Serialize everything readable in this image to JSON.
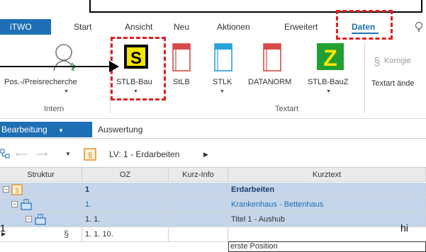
{
  "menubar": {
    "app": "iTWO",
    "items": [
      "Start",
      "Ansicht",
      "Neu",
      "Aktionen",
      "Erweitert",
      "Daten"
    ],
    "active": "Daten"
  },
  "ribbon": {
    "buttons": [
      {
        "label": "Pos.-/Preisrecherche",
        "icon": "search-person-icon"
      },
      {
        "label": "STLB-Bau",
        "icon": "stlb-s-icon"
      },
      {
        "label": "StLB",
        "icon": "red-book-icon"
      },
      {
        "label": "STLK",
        "icon": "blue-book-icon"
      },
      {
        "label": "DATANORM",
        "icon": "red-book-icon"
      },
      {
        "label": "STLB-BauZ",
        "icon": "stlb-z-icon"
      },
      {
        "label": "Korrigie",
        "icon": "paragraph-icon"
      },
      {
        "label": "Textart ände",
        "icon": ""
      }
    ],
    "groups": [
      "Intern",
      "Textart"
    ]
  },
  "tabs": {
    "bearbeitung": "Bearbeitung",
    "auswertung": "Auswertung"
  },
  "nav": {
    "breadcrumb": "LV: 1 - Erdarbeiten"
  },
  "grid": {
    "columns": [
      "Struktur",
      "OZ",
      "Kurz-Info",
      "Kurztext"
    ],
    "rows": [
      {
        "oz": "1",
        "kurzinfo": "",
        "kurztext": "Erdarbeiten",
        "style": "bold"
      },
      {
        "oz": "1.",
        "kurzinfo": "",
        "kurztext": "Krankenhaus - Bettenhaus",
        "style": "blue"
      },
      {
        "oz": "1. 1.",
        "kurzinfo": "",
        "kurztext": "Titel 1 - Aushub",
        "style": "normal"
      },
      {
        "oz": "1. 1. 10.",
        "kurzinfo": "",
        "kurztext": "erste Position",
        "style": "edit"
      }
    ]
  },
  "annotations": {
    "hi": "hi",
    "one": "1"
  },
  "colors": {
    "accent": "#1e6fb5",
    "highlight_dash": "#e02020",
    "selected_row": "#c5d5ea"
  }
}
